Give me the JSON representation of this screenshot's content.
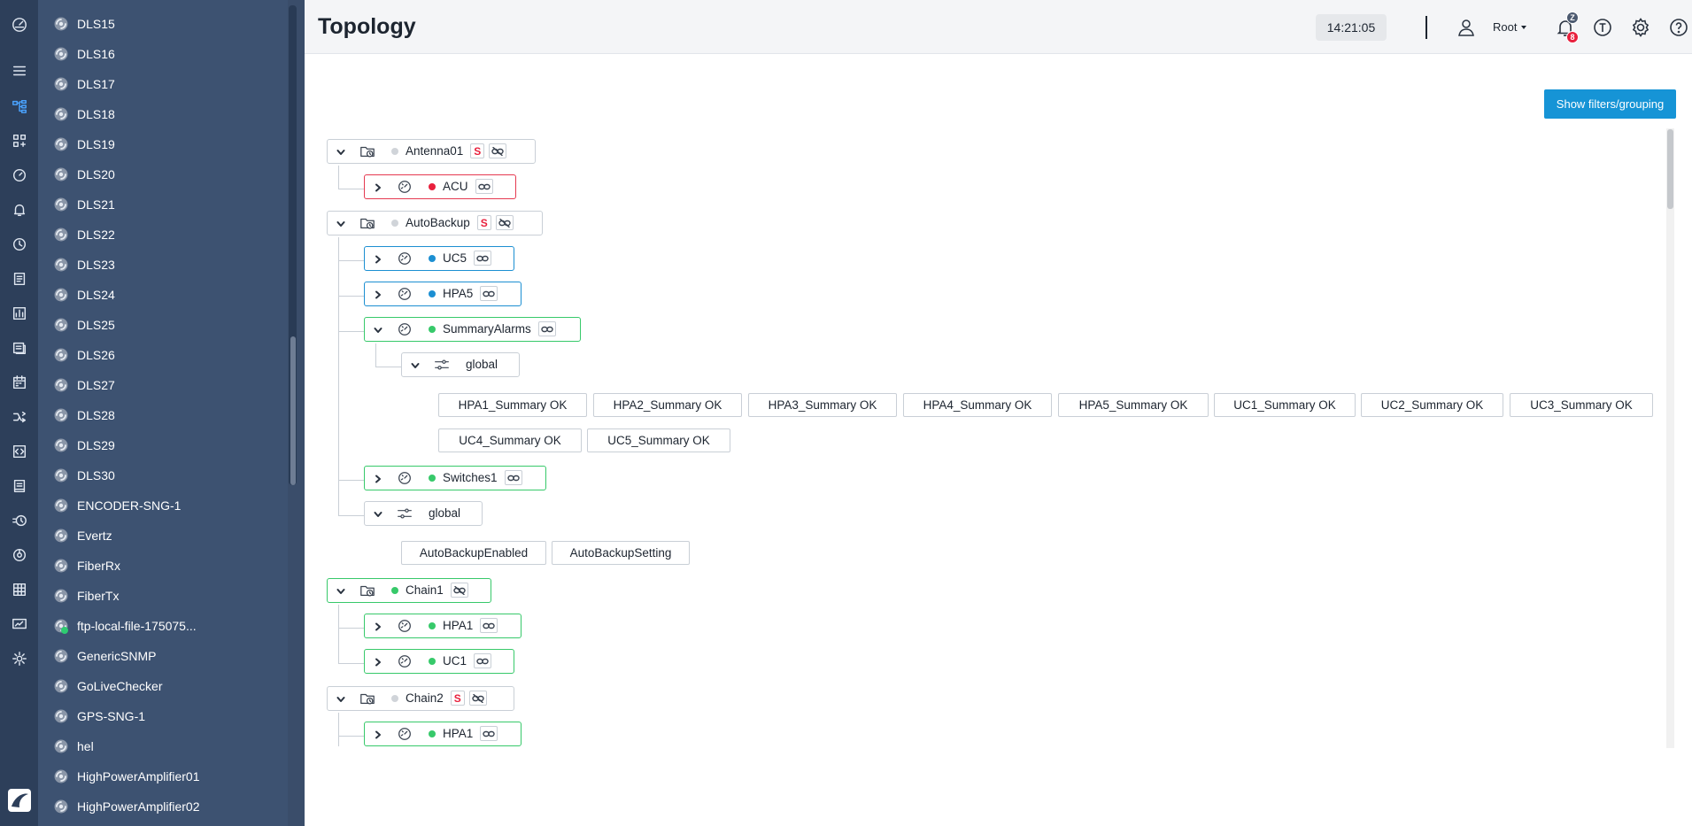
{
  "header": {
    "title": "Topology",
    "clock": "14:21:05",
    "user": "Root",
    "zzz_badge": "Z",
    "alerts_badge": "8",
    "t_label": "T"
  },
  "devices": [
    {
      "label": "DLS15"
    },
    {
      "label": "DLS16"
    },
    {
      "label": "DLS17"
    },
    {
      "label": "DLS18"
    },
    {
      "label": "DLS19"
    },
    {
      "label": "DLS20"
    },
    {
      "label": "DLS21"
    },
    {
      "label": "DLS22"
    },
    {
      "label": "DLS23"
    },
    {
      "label": "DLS24"
    },
    {
      "label": "DLS25"
    },
    {
      "label": "DLS26"
    },
    {
      "label": "DLS27"
    },
    {
      "label": "DLS28"
    },
    {
      "label": "DLS29"
    },
    {
      "label": "DLS30"
    },
    {
      "label": "ENCODER-SNG-1"
    },
    {
      "label": "Evertz"
    },
    {
      "label": "FiberRx"
    },
    {
      "label": "FiberTx"
    },
    {
      "label": "ftp-local-file-175075...",
      "online": true
    },
    {
      "label": "GenericSNMP"
    },
    {
      "label": "GoLiveChecker"
    },
    {
      "label": "GPS-SNG-1"
    },
    {
      "label": "hel"
    },
    {
      "label": "HighPowerAmplifier01"
    },
    {
      "label": "HighPowerAmplifier02"
    }
  ],
  "content": {
    "filters_button": "Show filters/grouping",
    "tree": {
      "antenna01": "Antenna01",
      "acu": "ACU",
      "autobackup": "AutoBackup",
      "uc5": "UC5",
      "hpa5": "HPA5",
      "summary_alarms": "SummaryAlarms",
      "global_1": "global",
      "switches1": "Switches1",
      "global_2": "global",
      "chain1": "Chain1",
      "chain1_hpa1": "HPA1",
      "chain1_uc1": "UC1",
      "chain2": "Chain2",
      "chain2_hpa1": "HPA1",
      "s_badge": "S"
    },
    "summaries": [
      "HPA1_Summary  OK",
      "HPA2_Summary  OK",
      "HPA3_Summary  OK",
      "HPA4_Summary  OK",
      "HPA5_Summary  OK",
      "UC1_Summary  OK",
      "UC2_Summary  OK",
      "UC3_Summary  OK",
      "UC4_Summary  OK",
      "UC5_Summary  OK"
    ],
    "autobackup_params": [
      "AutoBackupEnabled",
      "AutoBackupSetting"
    ]
  }
}
